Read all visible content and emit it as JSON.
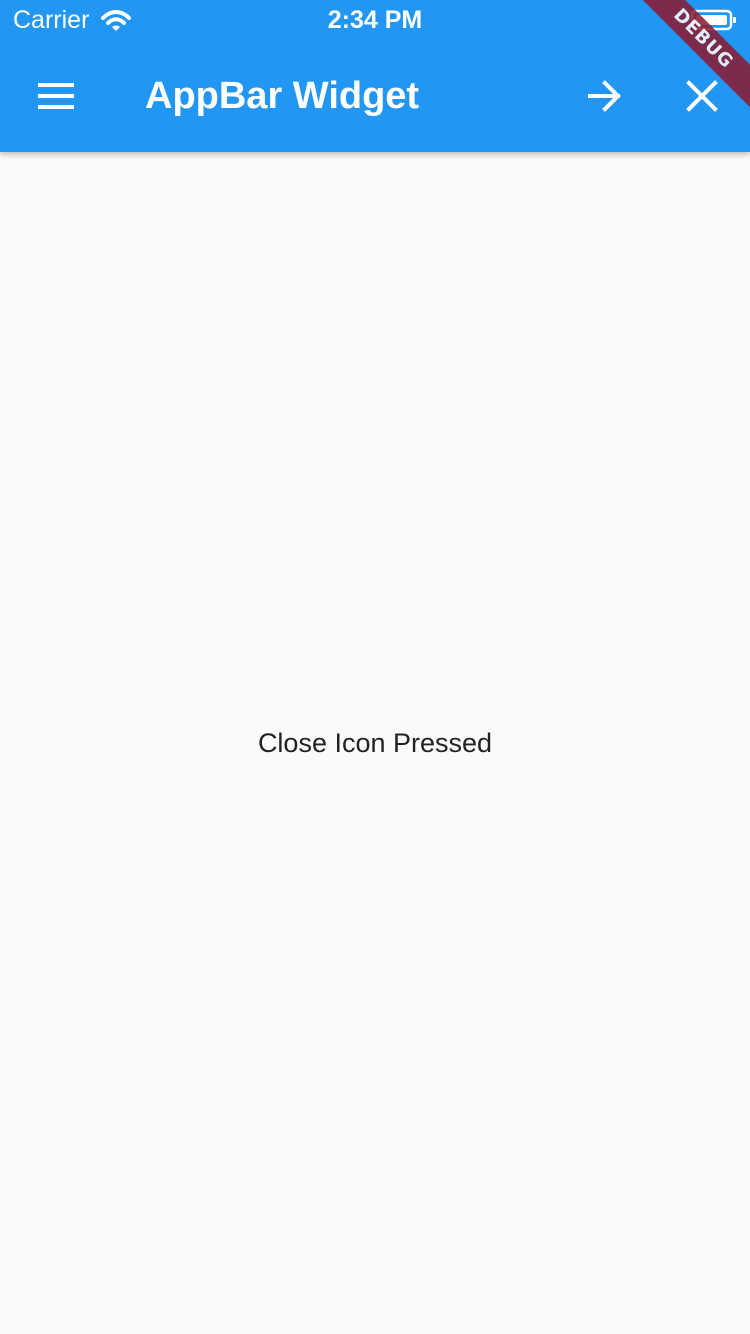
{
  "status_bar": {
    "carrier": "Carrier",
    "time": "2:34 PM",
    "icons": [
      "wifi-icon",
      "battery-icon"
    ]
  },
  "appbar": {
    "title": "AppBar Widget",
    "leading_icon": "menu-icon",
    "actions": [
      "arrow-forward-icon",
      "close-icon"
    ],
    "background_color": "#2196f3"
  },
  "debug_banner": {
    "label": "DEBUG",
    "color": "#8d1a2f"
  },
  "content": {
    "message": "Close Icon Pressed",
    "background_color": "#fafafa"
  }
}
